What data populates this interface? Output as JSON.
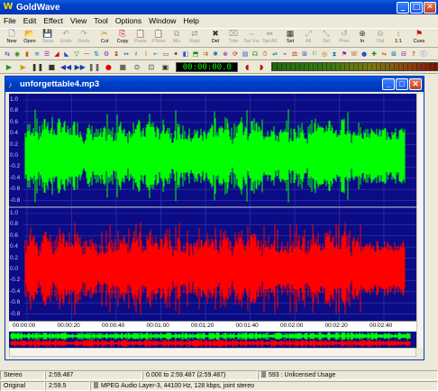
{
  "app": {
    "title": "GoldWave"
  },
  "menu": [
    "File",
    "Edit",
    "Effect",
    "View",
    "Tool",
    "Options",
    "Window",
    "Help"
  ],
  "toolbar": [
    {
      "label": "New",
      "icon": "new-file-icon",
      "enabled": true
    },
    {
      "label": "Open",
      "icon": "open-folder-icon",
      "enabled": true
    },
    {
      "label": "Save",
      "icon": "save-icon",
      "enabled": false
    },
    {
      "label": "Undo",
      "icon": "undo-icon",
      "enabled": false
    },
    {
      "label": "Redo",
      "icon": "redo-icon",
      "enabled": false
    },
    {
      "label": "Cut",
      "icon": "cut-icon",
      "enabled": true
    },
    {
      "label": "Copy",
      "icon": "copy-icon",
      "enabled": true
    },
    {
      "label": "Paste",
      "icon": "paste-icon",
      "enabled": false
    },
    {
      "label": "P.New",
      "icon": "paste-new-icon",
      "enabled": false
    },
    {
      "label": "Mix",
      "icon": "mix-icon",
      "enabled": false
    },
    {
      "label": "Repl",
      "icon": "replace-icon",
      "enabled": false
    },
    {
      "label": "Del",
      "icon": "delete-icon",
      "enabled": true
    },
    {
      "label": "Trim",
      "icon": "trim-icon",
      "enabled": false
    },
    {
      "label": "Sel Vw",
      "icon": "select-view-icon",
      "enabled": false
    },
    {
      "label": "Set All",
      "icon": "select-all-icon",
      "enabled": false
    },
    {
      "label": "Set",
      "icon": "set-icon",
      "enabled": true
    },
    {
      "label": "All",
      "icon": "zoom-all-icon",
      "enabled": false
    },
    {
      "label": "Sel",
      "icon": "zoom-sel-icon",
      "enabled": false
    },
    {
      "label": "Prev",
      "icon": "zoom-prev-icon",
      "enabled": false
    },
    {
      "label": "In",
      "icon": "zoom-in-icon",
      "enabled": true
    },
    {
      "label": "Out",
      "icon": "zoom-out-icon",
      "enabled": false
    },
    {
      "label": "1:1",
      "icon": "zoom-1-1-icon",
      "enabled": true
    },
    {
      "label": "Cues",
      "icon": "cues-icon",
      "enabled": true
    }
  ],
  "transport": {
    "time": "00:00:00.0"
  },
  "document": {
    "title": "unforgettable4.mp3"
  },
  "scale_labels": [
    "1.0",
    "0.8",
    "0.6",
    "0.4",
    "0.2",
    "0.0",
    "-0.2",
    "-0.4",
    "-0.6",
    "-0.8"
  ],
  "timeline": [
    "00:00:00",
    "00:00:20",
    "00:00:40",
    "00:01:00",
    "00:01:20",
    "00:01:40",
    "00:02:00",
    "00:02:20",
    "00:02:40"
  ],
  "status": {
    "row1": [
      "Stereo",
      "2:59.487",
      "0.000 to 2:59.487 (2:59.487)",
      "593 : Unlicensed Usage"
    ],
    "row2": [
      "Original",
      "2:59.5",
      "MPEG Audio Layer-3, 44100 Hz, 128 kbps, joint stereo",
      ""
    ]
  },
  "colors": {
    "left_channel": "#00ff00",
    "right_channel": "#ff0000",
    "wave_bg": "#0b0c85"
  }
}
